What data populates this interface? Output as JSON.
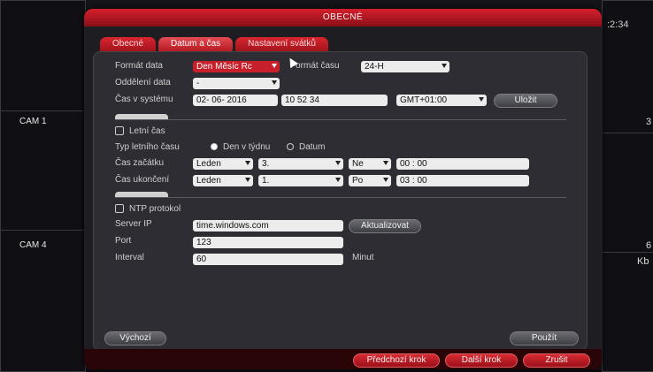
{
  "dialog": {
    "title": "OBECNÉ",
    "tabs": [
      {
        "label": "Obecné"
      },
      {
        "label": "Datum a čas"
      },
      {
        "label": "Nastavení svátků"
      }
    ]
  },
  "background": {
    "clock": ":2:34",
    "cams": [
      "CAM 1",
      "CAM 4"
    ],
    "right_edge": [
      "3",
      "6",
      "Kb"
    ]
  },
  "date": {
    "format_label": "Formát data",
    "format_value": "Den Měsíc Rc",
    "time_format_label": "Formát času",
    "time_format_value": "24-H",
    "separator_label": "Oddělení data",
    "separator_value": "-",
    "system_time_label": "Čas v systému",
    "system_date": "02- 06- 2016",
    "system_clock": "10  52  34",
    "timezone": "GMT+01:00",
    "save_label": "Uložit"
  },
  "dst": {
    "enabled_label": "Letní čas",
    "type_label": "Typ letního času",
    "option_week": "Den v týdnu",
    "option_date": "Datum",
    "start_label": "Čas začátku",
    "start_month": "Leden",
    "start_week": "3.",
    "start_day": "Ne",
    "start_time": "00  :  00",
    "end_label": "Čas ukončení",
    "end_month": "Leden",
    "end_week": "1.",
    "end_day": "Po",
    "end_time": "03  :  00"
  },
  "ntp": {
    "enabled_label": "NTP protokol",
    "server_label": "Server IP",
    "server_value": "time.windows.com",
    "update_label": "Aktualizovat",
    "port_label": "Port",
    "port_value": "123",
    "interval_label": "Interval",
    "interval_value": "60",
    "interval_unit": "Minut"
  },
  "buttons": {
    "default": "Výchozí",
    "apply": "Použít",
    "prev": "Předchozí krok",
    "next": "Další krok",
    "cancel": "Zrušit"
  }
}
